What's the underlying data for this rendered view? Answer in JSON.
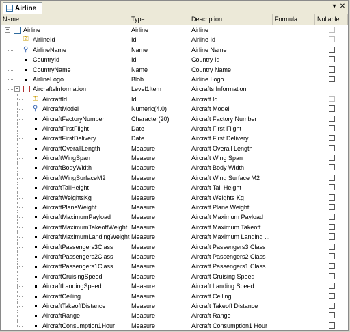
{
  "tab": {
    "title": "Airline"
  },
  "columns": {
    "name": "Name",
    "type": "Type",
    "description": "Description",
    "formula": "Formula",
    "nullable": "Nullable"
  },
  "rows": [
    {
      "name": "Airline",
      "type": "Airline",
      "desc": "Airline",
      "icon": "structure-icon",
      "level": 0,
      "nullable": false
    },
    {
      "name": "AirlineId",
      "type": "Id",
      "desc": "Airline Id",
      "icon": "key-icon",
      "level": 1,
      "nullable": false
    },
    {
      "name": "AirlineName",
      "type": "Name",
      "desc": "Airline Name",
      "icon": "description-icon",
      "level": 1,
      "nullable": false
    },
    {
      "name": "CountryId",
      "type": "Id",
      "desc": "Country Id",
      "icon": "attribute-icon",
      "level": 1,
      "nullable": false
    },
    {
      "name": "CountryName",
      "type": "Name",
      "desc": "Country Name",
      "icon": "attribute-icon",
      "level": 1,
      "nullable": false
    },
    {
      "name": "AirlineLogo",
      "type": "Blob",
      "desc": "Airline Logo",
      "icon": "attribute-icon",
      "level": 1,
      "nullable": false
    },
    {
      "name": "AircraftsInformation",
      "type": "Level1Item",
      "desc": "Aircrafts Information",
      "icon": "level-icon",
      "level": 1,
      "nullable": null
    },
    {
      "name": "AircraftId",
      "type": "Id",
      "desc": "Aircraft Id",
      "icon": "key-icon",
      "level": 2,
      "nullable": false
    },
    {
      "name": "AircraftModel",
      "type": "Numeric(4.0)",
      "desc": "Aircraft Model",
      "icon": "description-icon",
      "level": 2,
      "nullable": false
    },
    {
      "name": "AircraftFactoryNumber",
      "type": "Character(20)",
      "desc": "Aircraft Factory Number",
      "icon": "attribute-icon",
      "level": 2,
      "nullable": false
    },
    {
      "name": "AircraftFirstFlight",
      "type": "Date",
      "desc": "Aircraft First Flight",
      "icon": "attribute-icon",
      "level": 2,
      "nullable": false
    },
    {
      "name": "AircraftFirstDelivery",
      "type": "Date",
      "desc": "Aircraft First Delivery",
      "icon": "attribute-icon",
      "level": 2,
      "nullable": false
    },
    {
      "name": "AircraftOverallLength",
      "type": "Measure",
      "desc": "Aircraft Overall Length",
      "icon": "attribute-icon",
      "level": 2,
      "nullable": false
    },
    {
      "name": "AircraftWingSpan",
      "type": "Measure",
      "desc": "Aircraft Wing Span",
      "icon": "attribute-icon",
      "level": 2,
      "nullable": false
    },
    {
      "name": "AircraftBodyWidth",
      "type": "Measure",
      "desc": "Aircraft Body Width",
      "icon": "attribute-icon",
      "level": 2,
      "nullable": false
    },
    {
      "name": "AircraftWingSurfaceM2",
      "type": "Measure",
      "desc": "Aircraft Wing Surface M2",
      "icon": "attribute-icon",
      "level": 2,
      "nullable": false
    },
    {
      "name": "AircraftTailHeight",
      "type": "Measure",
      "desc": "Aircraft Tail Height",
      "icon": "attribute-icon",
      "level": 2,
      "nullable": false
    },
    {
      "name": "AircraftWeightsKg",
      "type": "Measure",
      "desc": "Aircraft Weights Kg",
      "icon": "attribute-icon",
      "level": 2,
      "nullable": false
    },
    {
      "name": "AircraftPlaneWeight",
      "type": "Measure",
      "desc": "Aircraft Plane Weight",
      "icon": "attribute-icon",
      "level": 2,
      "nullable": false
    },
    {
      "name": "AircraftMaximumPayload",
      "type": "Measure",
      "desc": "Aircraft Maximum Payload",
      "icon": "attribute-icon",
      "level": 2,
      "nullable": false
    },
    {
      "name": "AircraftMaximumTakeoffWeight",
      "type": "Measure",
      "desc": "Aircraft Maximum Takeoff ...",
      "icon": "attribute-icon",
      "level": 2,
      "nullable": false
    },
    {
      "name": "AircraftMaximumLandingWeight",
      "type": "Measure",
      "desc": "Aircraft Maximum Landing ...",
      "icon": "attribute-icon",
      "level": 2,
      "nullable": false
    },
    {
      "name": "AircraftPassengers3Class",
      "type": "Measure",
      "desc": "Aircraft Passengers3 Class",
      "icon": "attribute-icon",
      "level": 2,
      "nullable": false
    },
    {
      "name": "AircraftPassengers2Class",
      "type": "Measure",
      "desc": "Aircraft Passengers2 Class",
      "icon": "attribute-icon",
      "level": 2,
      "nullable": false
    },
    {
      "name": "AircraftPassengers1Class",
      "type": "Measure",
      "desc": "Aircraft Passengers1 Class",
      "icon": "attribute-icon",
      "level": 2,
      "nullable": false
    },
    {
      "name": "AircraftCruisingSpeed",
      "type": "Measure",
      "desc": "Aircraft Cruising Speed",
      "icon": "attribute-icon",
      "level": 2,
      "nullable": false
    },
    {
      "name": "AircraftLandingSpeed",
      "type": "Measure",
      "desc": "Aircraft Landing Speed",
      "icon": "attribute-icon",
      "level": 2,
      "nullable": false
    },
    {
      "name": "AircraftCeiling",
      "type": "Measure",
      "desc": "Aircraft Ceiling",
      "icon": "attribute-icon",
      "level": 2,
      "nullable": false
    },
    {
      "name": "AircraftTakeoffDistance",
      "type": "Measure",
      "desc": "Aircraft Takeoff Distance",
      "icon": "attribute-icon",
      "level": 2,
      "nullable": false
    },
    {
      "name": "AircraftRange",
      "type": "Measure",
      "desc": "Aircraft Range",
      "icon": "attribute-icon",
      "level": 2,
      "nullable": false
    },
    {
      "name": "AircraftConsumption1Hour",
      "type": "Measure",
      "desc": "Aircraft Consumption1 Hour",
      "icon": "attribute-icon",
      "level": 2,
      "nullable": false
    }
  ]
}
